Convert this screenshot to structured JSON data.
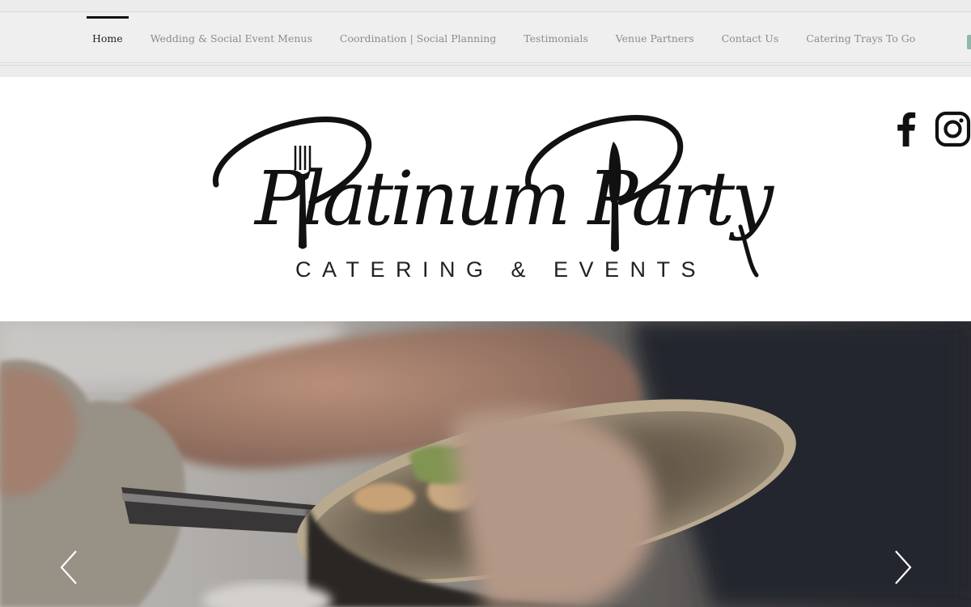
{
  "nav": {
    "items": [
      {
        "label": "Home",
        "active": true
      },
      {
        "label": "Wedding & Social Event Menus",
        "active": false
      },
      {
        "label": "Coordination | Social Planning",
        "active": false
      },
      {
        "label": "Testimonials",
        "active": false
      },
      {
        "label": "Venue Partners",
        "active": false
      },
      {
        "label": "Contact Us",
        "active": false
      },
      {
        "label": "Catering Trays To Go",
        "active": false
      }
    ]
  },
  "logo": {
    "script_text": "Platinum Party",
    "tagline": "CATERING & EVENTS"
  },
  "social": {
    "icons": [
      "facebook-icon",
      "instagram-icon"
    ]
  },
  "hero": {
    "prev_icon": "chevron-left-icon",
    "next_icon": "chevron-right-icon"
  },
  "colors": {
    "nav_active": "#222222",
    "nav_inactive": "#8c8c8c",
    "nav_background": "#efefef",
    "accent_edge": "#8fb8aa",
    "logo_ink": "#111111"
  }
}
